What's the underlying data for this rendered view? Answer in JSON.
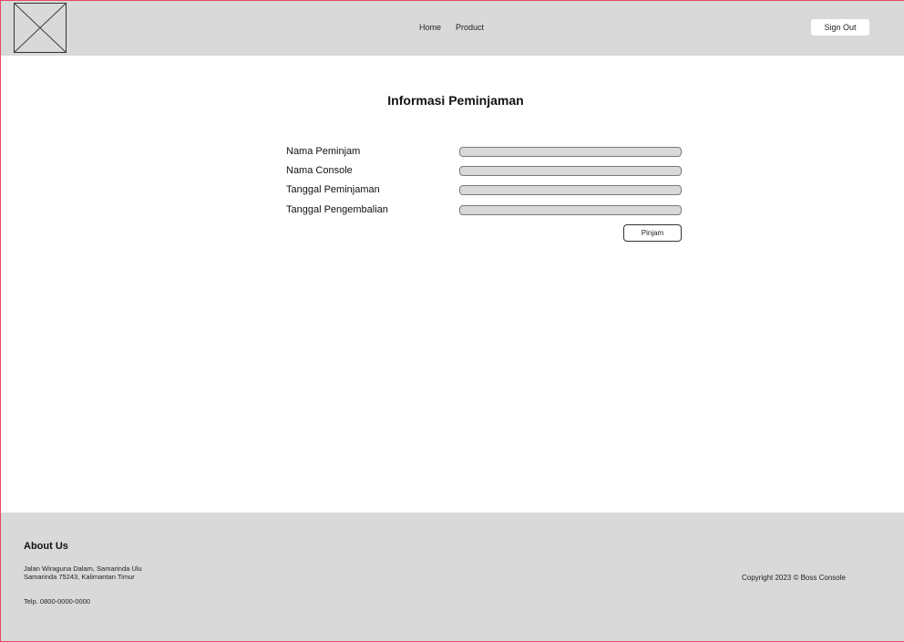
{
  "header": {
    "nav": [
      {
        "label": "Home"
      },
      {
        "label": "Product"
      }
    ],
    "signout_label": "Sign Out"
  },
  "main": {
    "title": "Informasi Peminjaman",
    "fields": [
      {
        "label": "Nama Peminjam",
        "value": ""
      },
      {
        "label": "Nama Console",
        "value": ""
      },
      {
        "label": "Tanggal Peminjaman",
        "value": ""
      },
      {
        "label": "Tanggal Pengembalian",
        "value": ""
      }
    ],
    "submit_label": "Pinjam"
  },
  "footer": {
    "about_title": "About Us",
    "address_line1": "Jalan Wiraguna Dalam, Samarinda Ulu",
    "address_line2": "Samarinda 75243, Kalimantan Timur",
    "phone": "Telp. 0800-0000-0000",
    "copyright": "Copyright 2023 © Boss Console"
  },
  "colors": {
    "header_bg": "#d9d9d9",
    "footer_bg": "#d9d9d9",
    "field_bg": "#d9d9d9",
    "frame_border": "#e8476a"
  }
}
